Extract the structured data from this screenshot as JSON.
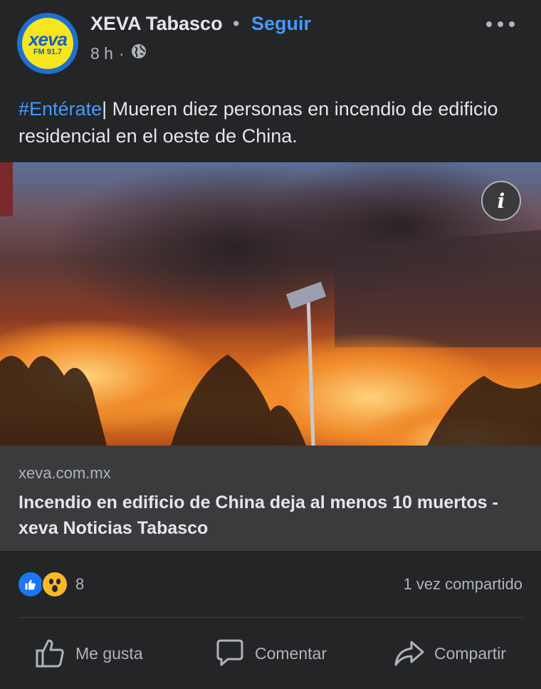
{
  "post": {
    "page_name": "XEVA Tabasco",
    "separator": "•",
    "follow_label": "Seguir",
    "time": "8 h",
    "time_sep": "·",
    "logo": {
      "word": "xeva",
      "sub": "FM 91.7"
    },
    "hashtag": "#Entérate",
    "text_pipe": "|",
    "text": " Mueren diez personas en incendio de edificio residencial en el oeste de China."
  },
  "link_preview": {
    "domain": "xeva.com.mx",
    "title": "Incendio en edificio de China deja al menos 10 muertos - xeva Noticias Tabasco",
    "info_label": "i"
  },
  "stats": {
    "reactions_count": "8",
    "shares": "1 vez compartido"
  },
  "actions": {
    "like": "Me gusta",
    "comment": "Comentar",
    "share": "Compartir"
  },
  "icons": {
    "more": "more-horizontal-icon",
    "globe": "globe-icon",
    "info": "info-icon",
    "like_reaction": "like-reaction-icon",
    "wow_reaction": "wow-reaction-icon"
  },
  "colors": {
    "background": "#242526",
    "link_box": "#3a3b3c",
    "accent": "#4599ff",
    "text": "#e4e6eb",
    "muted": "#b0b3b8"
  }
}
